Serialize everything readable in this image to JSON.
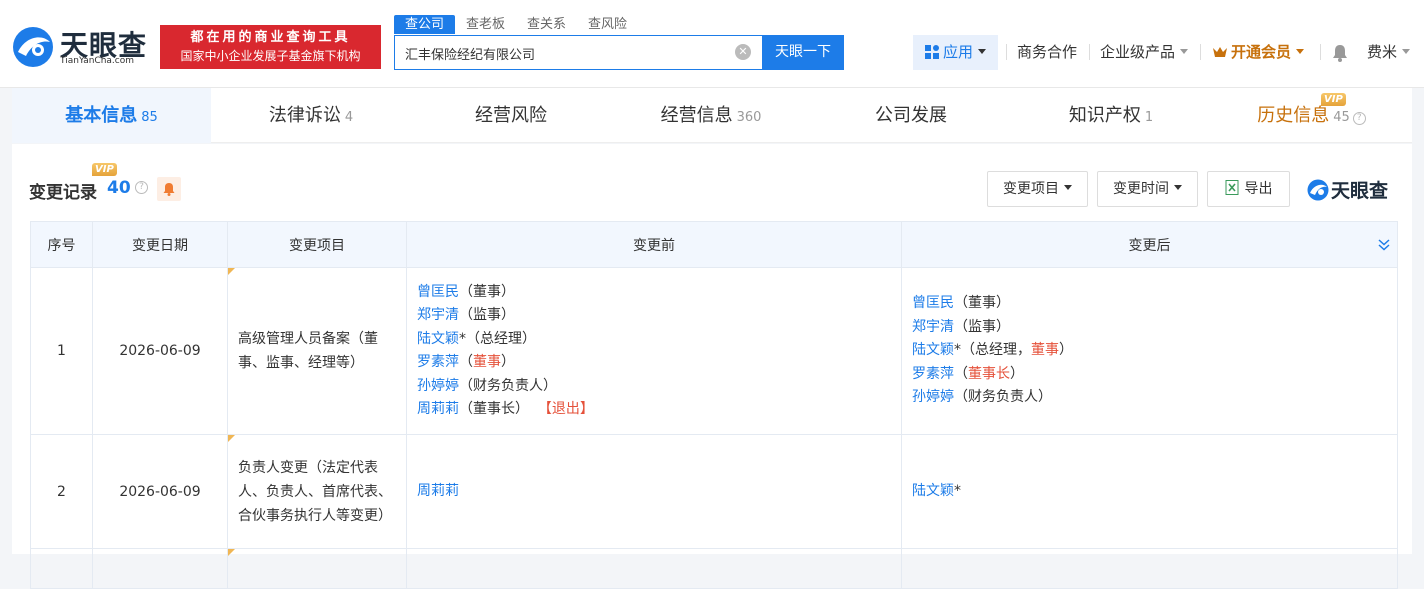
{
  "header": {
    "logo_name": "天眼查",
    "logo_domain": "TianYanCha.com",
    "slogan_line1": "都在用的商业查询工具",
    "slogan_line2": "国家中小企业发展子基金旗下机构",
    "search_tabs": [
      {
        "label": "查公司",
        "active": true
      },
      {
        "label": "查老板",
        "active": false
      },
      {
        "label": "查关系",
        "active": false
      },
      {
        "label": "查风险",
        "active": false
      }
    ],
    "search_value": "汇丰保险经纪有限公司",
    "search_button": "天眼一下",
    "nav": {
      "app": "应用",
      "business": "商务合作",
      "enterprise": "企业级产品",
      "vip": "开通会员",
      "user": "费米"
    }
  },
  "tabs": [
    {
      "label": "基本信息",
      "count": "85",
      "active": true
    },
    {
      "label": "法律诉讼",
      "count": "4"
    },
    {
      "label": "经营风险",
      "count": ""
    },
    {
      "label": "经营信息",
      "count": "360"
    },
    {
      "label": "公司发展",
      "count": ""
    },
    {
      "label": "知识产权",
      "count": "1"
    },
    {
      "label": "历史信息",
      "count": "45",
      "vip": "VIP"
    }
  ],
  "section": {
    "title": "变更记录",
    "count": "40",
    "vip": "VIP",
    "filter_item": "变更项目",
    "filter_time": "变更时间",
    "export": "导出",
    "brand": "天眼查"
  },
  "table": {
    "headers": [
      "序号",
      "变更日期",
      "变更项目",
      "变更前",
      "变更后"
    ],
    "rows": [
      {
        "index": "1",
        "date": "2026-06-09",
        "item": "高级管理人员备案（董事、监事、经理等）",
        "before": [
          {
            "name": "曾匡民",
            "role": "（董事）"
          },
          {
            "name": "郑宇清",
            "role": "（监事）"
          },
          {
            "name": "陆文颖",
            "star": "*",
            "role": "（总经理）"
          },
          {
            "name": "罗素萍",
            "role_pre": "（",
            "role_red": "董事",
            "role_post": "）"
          },
          {
            "name": "孙婷婷",
            "role": "（财务负责人）"
          },
          {
            "name": "周莉莉",
            "role": "（董事长）",
            "tag": "【退出】"
          }
        ],
        "after": [
          {
            "name": "曾匡民",
            "role": "（董事）"
          },
          {
            "name": "郑宇清",
            "role": "（监事）"
          },
          {
            "name": "陆文颖",
            "star": "*",
            "role_pre": "（总经理，",
            "role_red": "董事",
            "role_post": "）"
          },
          {
            "name": "罗素萍",
            "role_pre": "（",
            "role_red": "董事长",
            "role_post": "）"
          },
          {
            "name": "孙婷婷",
            "role": "（财务负责人）"
          }
        ]
      },
      {
        "index": "2",
        "date": "2026-06-09",
        "item": "负责人变更（法定代表人、负责人、首席代表、合伙事务执行人等变更）",
        "before_name": "周莉莉",
        "after_name": "陆文颖",
        "after_star": "*"
      }
    ]
  },
  "colors": {
    "accent": "#1d7ce8",
    "brand_red": "#d9282f",
    "vip": "#c7710c",
    "warn": "#e5513a"
  }
}
